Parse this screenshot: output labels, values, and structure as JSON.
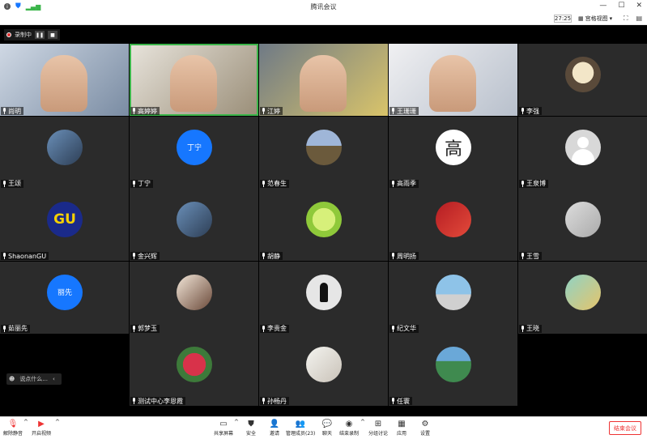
{
  "window": {
    "title": "腾讯会议",
    "timer": "27:25",
    "view_label": "宫格视图"
  },
  "recording": {
    "label": "录制中"
  },
  "chat": {
    "placeholder": "说点什么..."
  },
  "participants": [
    {
      "name": "尚明",
      "video": true,
      "muted": false
    },
    {
      "name": "高婷婷",
      "video": true,
      "muted": false,
      "speaking": true
    },
    {
      "name": "江婷",
      "video": true,
      "muted": false
    },
    {
      "name": "王珊珊",
      "video": true,
      "muted": true
    },
    {
      "name": "李强",
      "video": false,
      "muted": true,
      "avatar": "cartoon"
    },
    {
      "name": "王颂",
      "video": false,
      "muted": true,
      "avatar": "photo"
    },
    {
      "name": "丁宁",
      "video": false,
      "muted": true,
      "avatar_text": "丁宁",
      "avatar_color": "#1677ff"
    },
    {
      "name": "范春生",
      "video": false,
      "muted": true,
      "avatar": "landscape"
    },
    {
      "name": "高雨季",
      "video": false,
      "muted": true,
      "avatar_text": "高",
      "avatar_color": "#ffffff",
      "avatar_text_color": "#222222"
    },
    {
      "name": "王泉博",
      "video": false,
      "muted": true,
      "avatar": "default"
    },
    {
      "name": "ShaonanGU",
      "video": false,
      "muted": true,
      "avatar_text": "GU",
      "avatar_color": "#1a2a8a",
      "avatar_text_color": "#f5d000"
    },
    {
      "name": "金兴辉",
      "video": false,
      "muted": true,
      "avatar": "photo"
    },
    {
      "name": "胡静",
      "video": false,
      "muted": true,
      "avatar": "lime"
    },
    {
      "name": "周明扬",
      "video": false,
      "muted": true,
      "avatar": "red"
    },
    {
      "name": "王雪",
      "video": false,
      "muted": true,
      "avatar": "grey"
    },
    {
      "name": "茹丽先",
      "video": false,
      "muted": true,
      "avatar_text": "丽先",
      "avatar_color": "#1677ff"
    },
    {
      "name": "郭梦玉",
      "video": false,
      "muted": true,
      "avatar": "dog"
    },
    {
      "name": "李贵金",
      "video": false,
      "muted": true,
      "avatar": "silhouette"
    },
    {
      "name": "纪文华",
      "video": false,
      "muted": true,
      "avatar": "bike"
    },
    {
      "name": "王晓",
      "video": false,
      "muted": true,
      "avatar": "tree"
    },
    {
      "name": "测试中心李恩霞",
      "video": false,
      "muted": true,
      "avatar": "flower"
    },
    {
      "name": "孙畅丹",
      "video": false,
      "muted": true,
      "avatar": "cat"
    },
    {
      "name": "任寰",
      "video": false,
      "muted": true,
      "avatar": "scenery"
    }
  ],
  "toolbar": {
    "unmute": "解除静音",
    "start_video": "开启视频",
    "share_screen": "共享屏幕",
    "security": "安全",
    "invite": "邀请",
    "manage_members": "管理成员(23)",
    "chat": "聊天",
    "record": "结束录制",
    "breakout": "分组讨论",
    "apps": "应用",
    "settings": "设置",
    "end_meeting": "结束会议"
  },
  "colors": {
    "meeting_bg": "#000000",
    "tile_bg": "#2b2b2b",
    "accent_blue": "#1677ff",
    "end_red": "#e33333",
    "speaking_green": "#3bb54a"
  }
}
